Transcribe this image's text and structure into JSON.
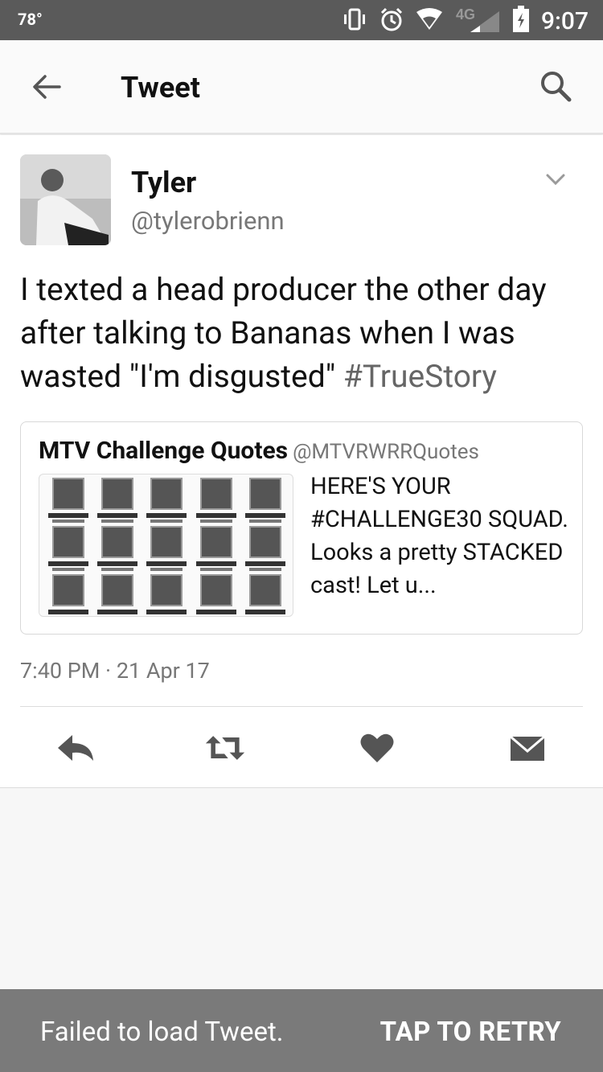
{
  "status_bar": {
    "temperature": "78°",
    "network": "4G",
    "time": "9:07"
  },
  "header": {
    "title": "Tweet"
  },
  "tweet": {
    "name": "Tyler",
    "handle": "@tylerobrienn",
    "text": "I texted a head producer the other day after talking to Bananas when I was wasted \"I'm disgusted\" ",
    "hashtag": "#TrueStory",
    "timestamp": "7:40 PM · 21 Apr 17"
  },
  "quoted_tweet": {
    "name": "MTV Challenge Quotes",
    "handle": "@MTVRWRRQuotes",
    "text": "HERE'S YOUR #CHALLENGE30 SQUAD. Looks a pretty STACKED cast! Let u..."
  },
  "actions": {
    "reply_icon": "reply-icon",
    "retweet_icon": "retweet-icon",
    "like_icon": "heart-icon",
    "dm_icon": "envelope-icon"
  },
  "snackbar": {
    "message": "Failed to load Tweet.",
    "action": "TAP TO RETRY"
  }
}
